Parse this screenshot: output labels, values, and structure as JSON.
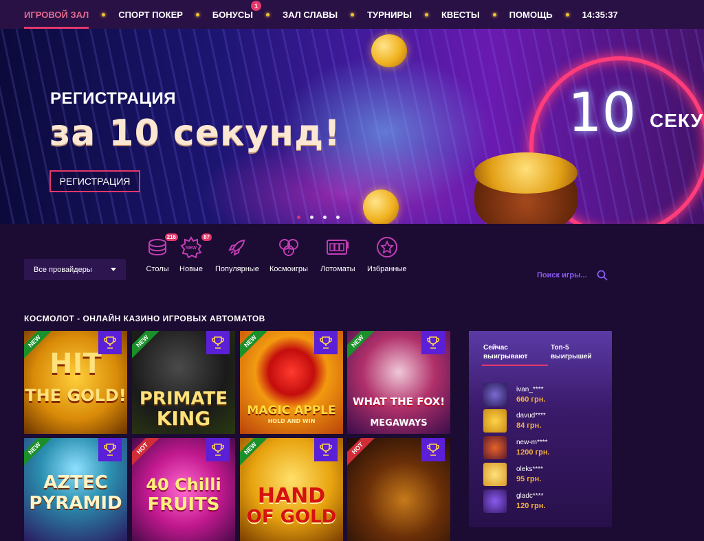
{
  "nav": {
    "items": [
      {
        "label": "ИГРОВОЙ ЗАЛ"
      },
      {
        "label": "СПОРТ ПОКЕР"
      },
      {
        "label": "БОНУСЫ",
        "badge": "1"
      },
      {
        "label": "ЗАЛ СЛАВЫ"
      },
      {
        "label": "ТУРНИРЫ"
      },
      {
        "label": "КВЕСТЫ"
      },
      {
        "label": "ПОМОЩЬ"
      }
    ],
    "clock": "14:35:37"
  },
  "banner": {
    "subtitle": "РЕГИСТРАЦИЯ",
    "title": "за 10 секунд!",
    "button": "РЕГИСТРАЦИЯ",
    "timer_number": "10",
    "timer_word": "СЕКУ",
    "slides": 4,
    "active_slide": 1
  },
  "filters": {
    "provider": "Все провайдеры",
    "categories": [
      {
        "label": "Столы",
        "badge": "216",
        "icon": "chips-icon"
      },
      {
        "label": "Новые",
        "badge": "87",
        "icon": "new-badge-icon"
      },
      {
        "label": "Популярные",
        "icon": "rocket-icon"
      },
      {
        "label": "Космоигры",
        "icon": "lucky-sevens-icon"
      },
      {
        "label": "Лотоматы",
        "icon": "slot-machine-icon"
      },
      {
        "label": "Избранные",
        "icon": "star-icon"
      }
    ],
    "search_placeholder": "Поиск игры..."
  },
  "section_title": "КОСМОЛОТ - ОНЛАЙН КАЗИНО ИГРОВЫХ АВТОМАТОВ",
  "games": [
    {
      "name_line1": "HIT",
      "name_line2": "THE GOLD!",
      "ribbon": "NEW"
    },
    {
      "name_line1": "PRIMATE",
      "name_line2": "KING",
      "ribbon": "NEW"
    },
    {
      "name_line1": "MAGIC APPLE",
      "name_line2": "HOLD AND WIN",
      "ribbon": "NEW"
    },
    {
      "name_line1": "WHAT THE FOX!",
      "name_line2": "MEGAWAYS",
      "ribbon": "NEW"
    },
    {
      "name_line1": "AZTEC",
      "name_line2": "PYRAMID",
      "ribbon": "NEW"
    },
    {
      "name_line1": "40 Chilli",
      "name_line2": "FRUITS",
      "ribbon": "HOT"
    },
    {
      "name_line1": "HAND",
      "name_line2": "OF GOLD",
      "ribbon": "NEW"
    },
    {
      "name_line1": "",
      "name_line2": "",
      "ribbon": "HOT"
    }
  ],
  "winners": {
    "tab_active": "Сейчас выигрывают",
    "tab_other": "Топ-5 выигрышей",
    "rows": [
      {
        "user": "ivan_****",
        "amount": "660 грн.",
        "color": "#2a1d5a"
      },
      {
        "user": "davud****",
        "amount": "84 грн.",
        "color": "#c98c13"
      },
      {
        "user": "new-m****",
        "amount": "1200 грн.",
        "color": "#5a1a2e"
      },
      {
        "user": "oleks****",
        "amount": "95 грн.",
        "color": "#d89a2a"
      },
      {
        "user": "gladc****",
        "amount": "120 грн.",
        "color": "#3a1a6a"
      }
    ]
  }
}
